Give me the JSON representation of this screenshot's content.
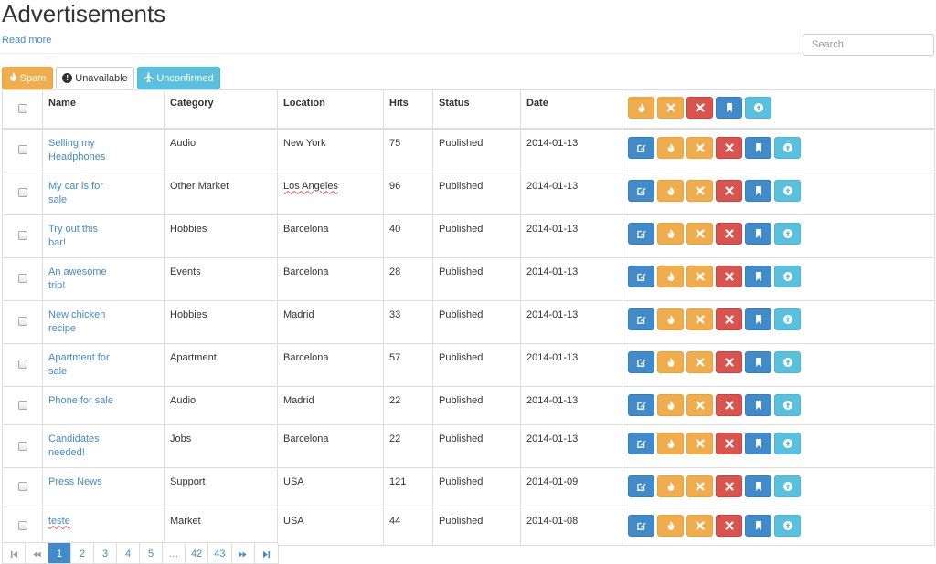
{
  "page": {
    "title": "Advertisements",
    "read_more": "Read more"
  },
  "search": {
    "placeholder": "Search",
    "value": ""
  },
  "filters": [
    {
      "label": "Spam",
      "icon": "fire-icon"
    },
    {
      "label": "Unavailable",
      "icon": "exclamation-circle-icon"
    },
    {
      "label": "Unconfirmed",
      "icon": "plane-icon"
    }
  ],
  "table": {
    "headers": {
      "name": "Name",
      "category": "Category",
      "location": "Location",
      "hits": "Hits",
      "status": "Status",
      "date": "Date"
    },
    "header_actions": [
      "fire-icon",
      "times-icon",
      "times-icon",
      "bookmark-icon",
      "arrow-up-circle-icon"
    ],
    "row_actions": [
      "edit-icon",
      "fire-icon",
      "times-icon",
      "times-icon",
      "bookmark-icon",
      "arrow-up-circle-icon"
    ],
    "rows": [
      {
        "name_line1": "Selling my",
        "name_line2": "Headphones",
        "category": "Audio",
        "location": "New York",
        "hits": "75",
        "status": "Published",
        "date": "2014-01-13"
      },
      {
        "name_line1": "My car is for",
        "name_line2": "sale",
        "category": "Other Market",
        "location": "Los Angeles",
        "hits": "96",
        "status": "Published",
        "date": "2014-01-13"
      },
      {
        "name_line1": "Try out this",
        "name_line2": "bar!",
        "category": "Hobbies",
        "location": "Barcelona",
        "hits": "40",
        "status": "Published",
        "date": "2014-01-13"
      },
      {
        "name_line1": "An awesome",
        "name_line2": "trip!",
        "category": "Events",
        "location": "Barcelona",
        "hits": "28",
        "status": "Published",
        "date": "2014-01-13"
      },
      {
        "name_line1": "New chicken",
        "name_line2": "recipe",
        "category": "Hobbies",
        "location": "Madrid",
        "hits": "33",
        "status": "Published",
        "date": "2014-01-13"
      },
      {
        "name_line1": "Apartment for",
        "name_line2": "sale",
        "category": "Apartment",
        "location": "Barcelona",
        "hits": "57",
        "status": "Published",
        "date": "2014-01-13"
      },
      {
        "name_line1": "Phone for sale",
        "name_line2": "",
        "category": "Audio",
        "location": "Madrid",
        "hits": "22",
        "status": "Published",
        "date": "2014-01-13"
      },
      {
        "name_line1": "Candidates",
        "name_line2": "needed!",
        "category": "Jobs",
        "location": "Barcelona",
        "hits": "22",
        "status": "Published",
        "date": "2014-01-13"
      },
      {
        "name_line1": "Press News",
        "name_line2": "",
        "category": "Support",
        "location": "USA",
        "hits": "121",
        "status": "Published",
        "date": "2014-01-09"
      },
      {
        "name_line1": "teste",
        "name_line2": "",
        "category": "Market",
        "location": "USA",
        "hits": "44",
        "status": "Published",
        "date": "2014-01-08"
      }
    ]
  },
  "pagination": {
    "first_icon": "first-page-icon",
    "prev_icon": "previous-page-icon",
    "pages": [
      "1",
      "2",
      "3",
      "4",
      "5",
      "…",
      "42",
      "43"
    ],
    "current": "1",
    "next_icon": "next-page-icon",
    "last_icon": "last-page-icon"
  },
  "colors": {
    "primary": "#428bca",
    "warning": "#f0ad4e",
    "danger": "#d9534f",
    "info": "#5bc0de",
    "link": "#428bca"
  }
}
